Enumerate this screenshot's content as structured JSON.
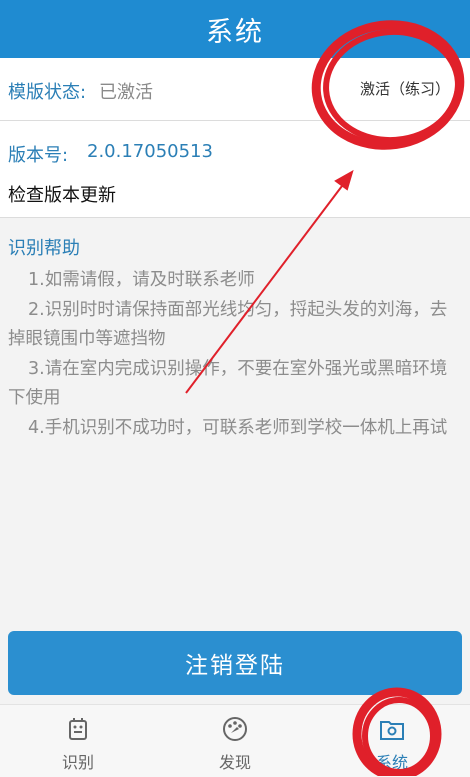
{
  "header": {
    "title": "系统"
  },
  "status": {
    "label": "模版状态:",
    "value": "已激活",
    "action": "激活（练习）",
    "chevron": "›"
  },
  "version": {
    "label": "版本号:",
    "value": "2.0.17050513",
    "check_update": "检查版本更新"
  },
  "help": {
    "title": "识别帮助",
    "items": [
      "1.如需请假，请及时联系老师",
      "2.识别时时请保持面部光线均匀，捋起头发的刘海，去掉眼镜围巾等遮挡物",
      "3.请在室内完成识别操作，不要在室外强光或黑暗环境下使用",
      "4.手机识别不成功时，可联系老师到学校一体机上再试"
    ]
  },
  "logout": {
    "label": "注销登陆"
  },
  "tabs": [
    {
      "label": "识别",
      "icon": "recognize-icon"
    },
    {
      "label": "发现",
      "icon": "discover-icon"
    },
    {
      "label": "系统",
      "icon": "system-icon",
      "active": true
    }
  ],
  "colors": {
    "primary": "#1f8bd1",
    "accent_text": "#2b7fb6",
    "annotation_red": "#e0202a"
  }
}
